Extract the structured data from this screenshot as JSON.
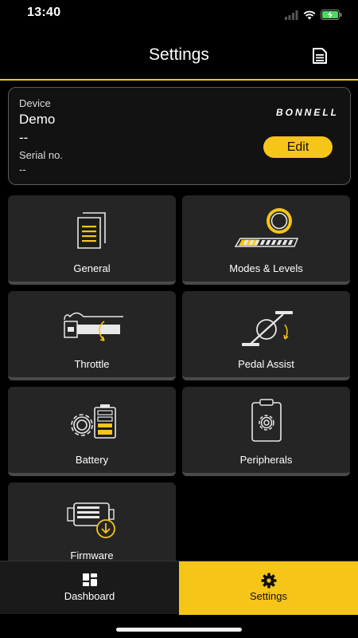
{
  "status": {
    "time": "13:40"
  },
  "header": {
    "title": "Settings"
  },
  "device": {
    "device_label": "Device",
    "device_name": "Demo",
    "device_sub": "--",
    "serial_label": "Serial no.",
    "serial_value": "--",
    "brand": "BONNELL",
    "edit_label": "Edit"
  },
  "tiles": [
    {
      "label": "General",
      "icon": "documents-icon"
    },
    {
      "label": "Modes & Levels",
      "icon": "levels-icon"
    },
    {
      "label": "Throttle",
      "icon": "throttle-icon"
    },
    {
      "label": "Pedal Assist",
      "icon": "pedal-assist-icon"
    },
    {
      "label": "Battery",
      "icon": "battery-gear-icon"
    },
    {
      "label": "Peripherals",
      "icon": "peripherals-icon"
    },
    {
      "label": "Firmware",
      "icon": "firmware-icon"
    }
  ],
  "nav": {
    "dashboard_label": "Dashboard",
    "settings_label": "Settings"
  },
  "colors": {
    "accent": "#f5c518",
    "tile": "#252525",
    "background": "#000000"
  }
}
